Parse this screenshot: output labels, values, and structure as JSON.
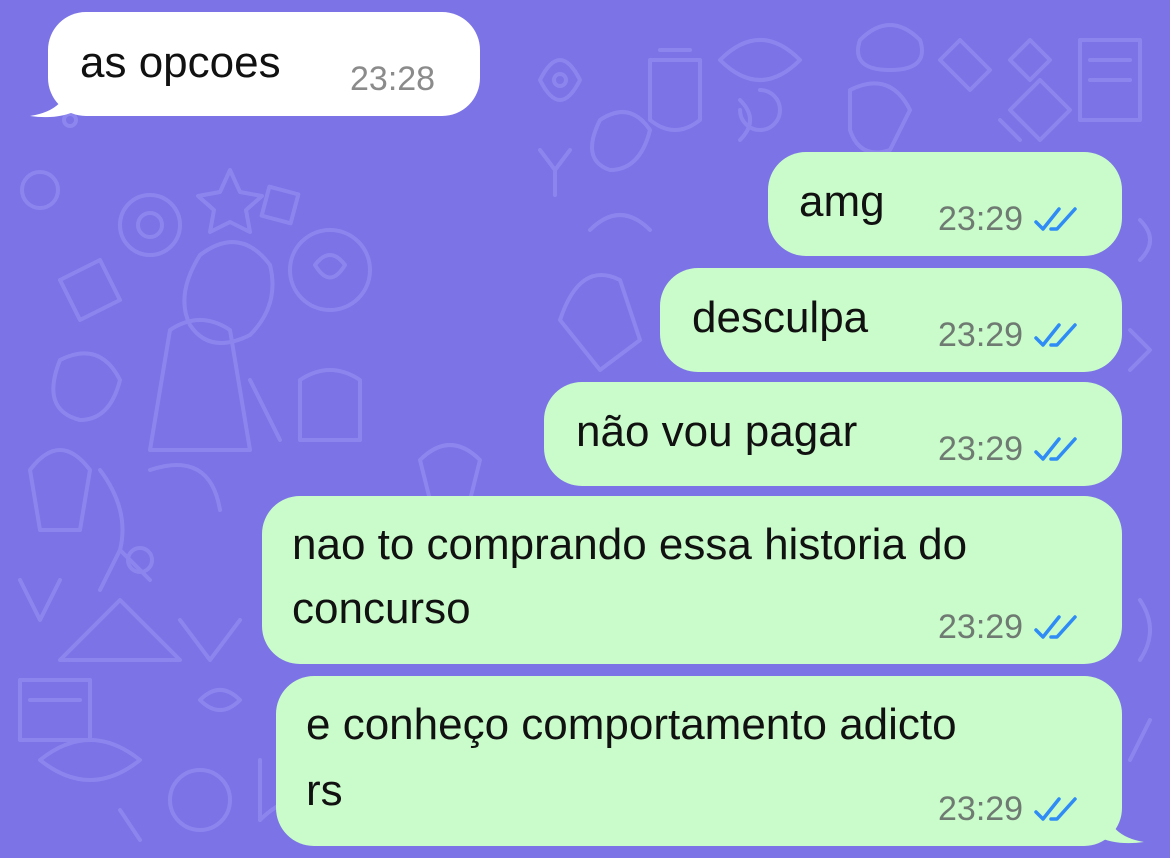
{
  "chat": {
    "messages": [
      {
        "direction": "incoming",
        "lines": [
          "as opcoes"
        ],
        "time": "23:28"
      },
      {
        "direction": "outgoing",
        "lines": [
          "amg"
        ],
        "time": "23:29",
        "status": "read"
      },
      {
        "direction": "outgoing",
        "lines": [
          "desculpa"
        ],
        "time": "23:29",
        "status": "read"
      },
      {
        "direction": "outgoing",
        "lines": [
          "não vou pagar"
        ],
        "time": "23:29",
        "status": "read"
      },
      {
        "direction": "outgoing",
        "lines": [
          "nao to comprando essa historia do",
          "concurso"
        ],
        "time": "23:29",
        "status": "read"
      },
      {
        "direction": "outgoing",
        "lines": [
          "e conheço comportamento adicto",
          "rs"
        ],
        "time": "23:29",
        "status": "read"
      }
    ]
  },
  "icons": {
    "read_receipt": "double-check-icon"
  },
  "colors": {
    "background": "#7b73e6",
    "incoming_bubble": "#ffffff",
    "outgoing_bubble": "#c9fcca",
    "read_tick": "#2f8bf5",
    "timestamp": "#6f7a72"
  }
}
